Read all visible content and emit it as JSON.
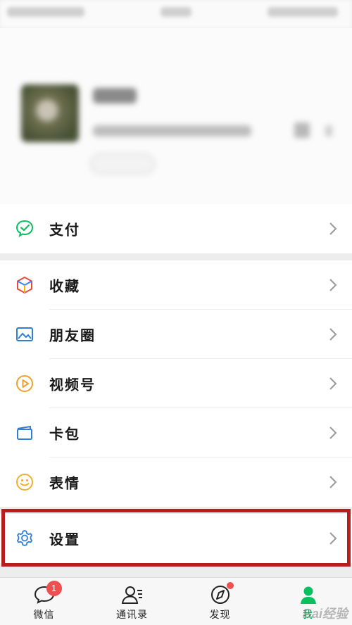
{
  "pay": {
    "label": "支付"
  },
  "menu": [
    {
      "label": "收藏"
    },
    {
      "label": "朋友圈"
    },
    {
      "label": "视频号"
    },
    {
      "label": "卡包"
    },
    {
      "label": "表情"
    }
  ],
  "settings": {
    "label": "设置"
  },
  "tabs": [
    {
      "label": "微信",
      "badge": "1"
    },
    {
      "label": "通讯录"
    },
    {
      "label": "发现"
    },
    {
      "label": "我"
    }
  ],
  "watermark": "Bai经验",
  "colors": {
    "accent_green": "#07c160",
    "highlight_red": "#b91c1c",
    "badge_red": "#f04f4f"
  }
}
